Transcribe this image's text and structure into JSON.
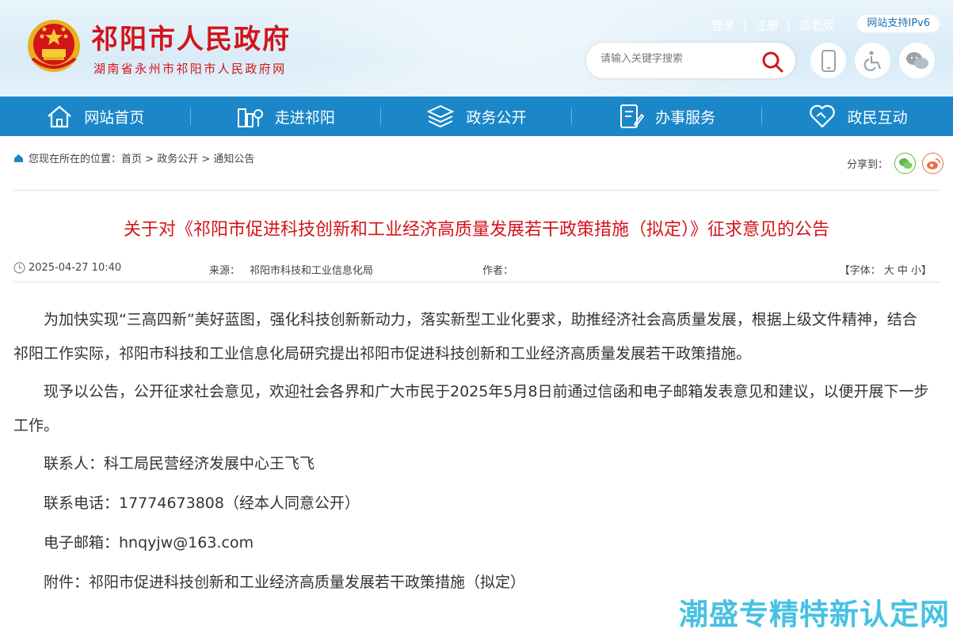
{
  "header": {
    "title": "祁阳市人民政府",
    "subtitle": "湖南省永州市祁阳市人民政府网",
    "links": [
      "登录",
      "注册",
      "适老版"
    ],
    "ipv6": "网站支持IPv6",
    "search_placeholder": "请输入关键字搜索"
  },
  "nav": {
    "items": [
      "网站首页",
      "走进祁阳",
      "政务公开",
      "办事服务",
      "政民互动"
    ]
  },
  "breadcrumb": {
    "prefix": "您现在所在的位置：",
    "items": [
      "首页",
      "政务公开",
      "通知公告"
    ],
    "sep": " > "
  },
  "share": {
    "label": "分享到："
  },
  "article": {
    "title": "关于对《祁阳市促进科技创新和工业经济高质量发展若干政策措施（拟定）》征求意见的公告",
    "date": "2025-04-27 10:40",
    "source_label": "来源：",
    "source": "祁阳市科技和工业信息化局",
    "author_label": "作者：",
    "font_label": "【字体： 大 中 小】",
    "p1": "为加快实现“三高四新”美好蓝图，强化科技创新新动力，落实新型工业化要求，助推经济社会高质量发展，根据上级文件精神，结合祁阳工作实际，祁阳市科技和工业信息化局研究提出祁阳市促进科技创新和工业经济高质量发展若干政策措施。",
    "p2": "现予以公告，公开征求社会意见，欢迎社会各界和广大市民于2025年5月8日前通过信函和电子邮箱发表意见和建议，以便开展下一步工作。",
    "contact": "联系人：科工局民营经济发展中心王飞飞",
    "phone": "联系电话：17774673808（经本人同意公开）",
    "email": "电子邮箱：hnqyjw@163.com",
    "attachment": "附件：祁阳市促进科技创新和工业经济高质量发展若干政策措施（拟定）"
  },
  "watermark": "潮盛专精特新认定网",
  "colors": {
    "brand_red": "#d3141b",
    "nav_blue": "#1b87c9"
  }
}
